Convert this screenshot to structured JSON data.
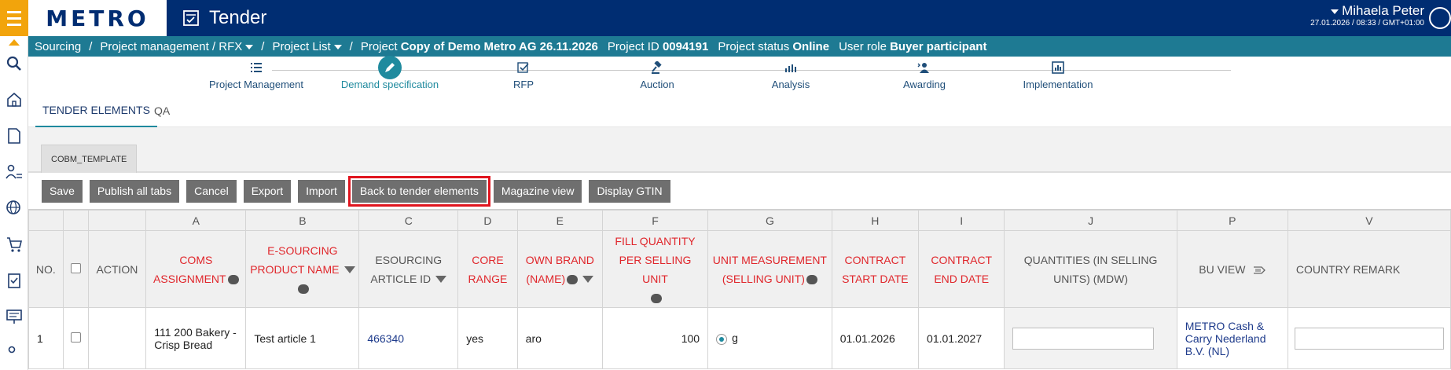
{
  "app": {
    "logo": "METRO",
    "title": "Tender"
  },
  "user": {
    "name": "Mihaela Peter",
    "datetime": "27.01.2026 / 08:33 / GMT+01:00"
  },
  "breadcrumb": {
    "sourcing": "Sourcing",
    "project_mgmt": "Project management / RFX",
    "project_list": "Project List",
    "project_label": "Project",
    "project_name": "Copy of Demo Metro AG 26.11.2026",
    "project_id_label": "Project ID",
    "project_id": "0094191",
    "status_label": "Project status",
    "status": "Online",
    "role_label": "User role",
    "role": "Buyer participant"
  },
  "workflow": [
    {
      "label": "Project Management",
      "icon": "list-icon"
    },
    {
      "label": "Demand specification",
      "icon": "edit-icon",
      "active": true
    },
    {
      "label": "RFP",
      "icon": "checkbox-icon"
    },
    {
      "label": "Auction",
      "icon": "gavel-icon"
    },
    {
      "label": "Analysis",
      "icon": "bar-chart-icon"
    },
    {
      "label": "Awarding",
      "icon": "award-icon"
    },
    {
      "label": "Implementation",
      "icon": "chart-box-icon"
    }
  ],
  "tabs": {
    "tender_elements": "TENDER ELEMENTS",
    "qa": "QA"
  },
  "subtab": "COBM_TEMPLATE",
  "toolbar": {
    "save": "Save",
    "publish": "Publish all tabs",
    "cancel": "Cancel",
    "export": "Export",
    "import": "Import",
    "back": "Back to tender elements",
    "magazine": "Magazine view",
    "gtin": "Display GTIN"
  },
  "table": {
    "letters": [
      "",
      "",
      "",
      "A",
      "B",
      "C",
      "D",
      "E",
      "F",
      "G",
      "H",
      "I",
      "J",
      "P",
      "V"
    ],
    "headers": {
      "no": "NO.",
      "action": "ACTION",
      "coms": "COMS ASSIGNMENT",
      "product_name": "E-SOURCING PRODUCT NAME",
      "article_id": "ESOURCING ARTICLE ID",
      "core_range": "CORE RANGE",
      "own_brand": "OWN BRAND (NAME)",
      "fill_qty": "FILL QUANTITY PER SELLING UNIT",
      "unit_meas": "UNIT MEASUREMENT (SELLING UNIT)",
      "contract_start": "CONTRACT START DATE",
      "contract_end": "CONTRACT END DATE",
      "quantities": "QUANTITIES (IN SELLING UNITS) (MDW)",
      "bu_view": "BU VIEW",
      "country_remark": "COUNTRY REMARK"
    },
    "row": {
      "no": "1",
      "coms": "111 200 Bakery - Crisp Bread",
      "product_name": "Test article 1",
      "article_id": "466340",
      "core_range": "yes",
      "own_brand": "aro",
      "fill_qty": "100",
      "unit": "g",
      "contract_start": "01.01.2026",
      "contract_end": "01.01.2027",
      "bu": "METRO Cash & Carry Nederland B.V. (NL)"
    }
  }
}
